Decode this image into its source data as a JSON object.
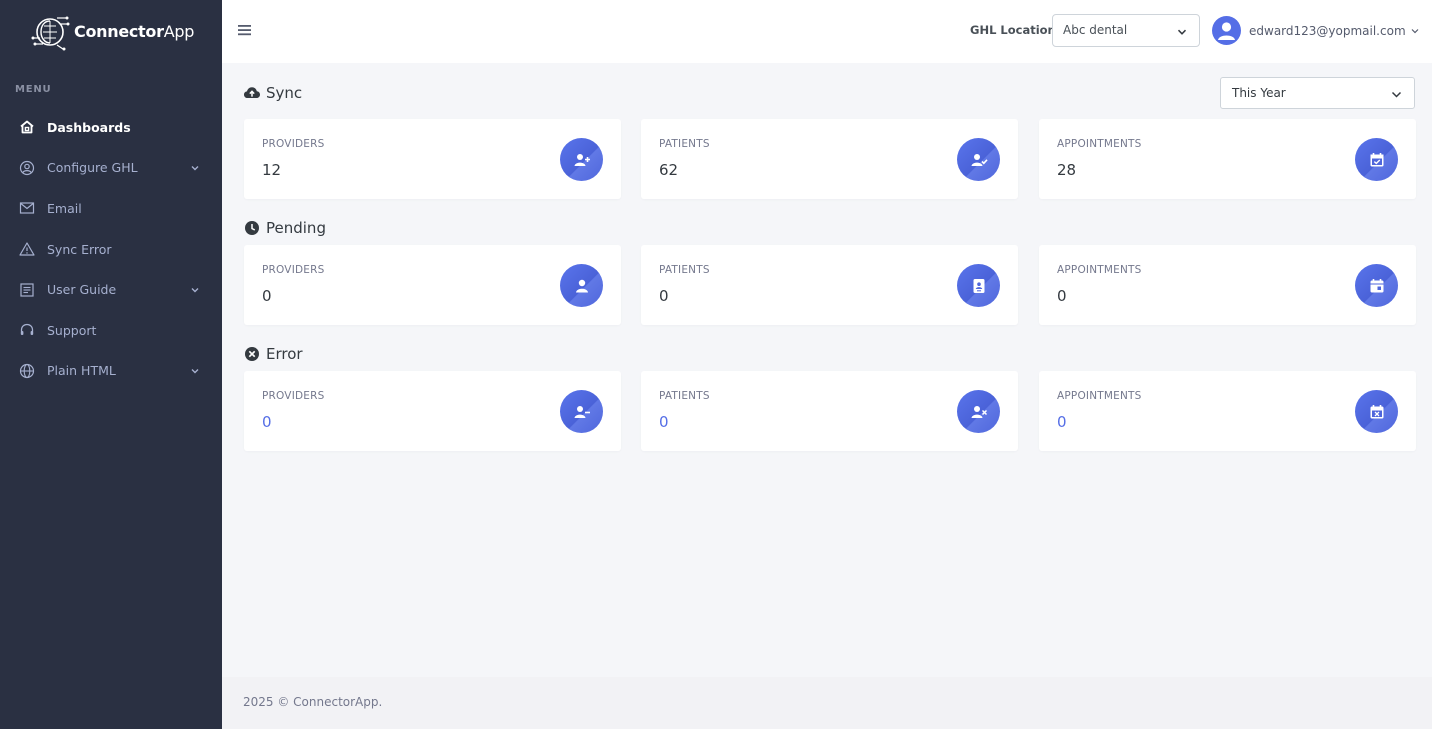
{
  "brand": {
    "name_bold": "Connector",
    "name_light": "App"
  },
  "sidebar": {
    "menu_title": "MENU",
    "items": [
      {
        "label": "Dashboards",
        "icon": "home-icon",
        "active": true,
        "has_submenu": false
      },
      {
        "label": "Configure GHL",
        "icon": "user-circle-icon",
        "active": false,
        "has_submenu": true
      },
      {
        "label": "Email",
        "icon": "envelope-icon",
        "active": false,
        "has_submenu": false
      },
      {
        "label": "Sync Error",
        "icon": "warning-icon",
        "active": false,
        "has_submenu": false
      },
      {
        "label": "User Guide",
        "icon": "document-icon",
        "active": false,
        "has_submenu": true
      },
      {
        "label": "Plain HTML",
        "icon": "globe-icon",
        "active": false,
        "has_submenu": true
      }
    ],
    "support_label": "Support"
  },
  "topbar": {
    "ghl_label": "GHL Location:",
    "ghl_value": "Abc dental",
    "user_email": "edward123@yopmail.com"
  },
  "filter": {
    "period": "This Year"
  },
  "sections": [
    {
      "title": "Sync",
      "icon": "cloud-upload-icon",
      "cards": [
        {
          "label": "PROVIDERS",
          "value": "12",
          "icon": "user-plus-icon"
        },
        {
          "label": "PATIENTS",
          "value": "62",
          "icon": "user-check-icon"
        },
        {
          "label": "APPOINTMENTS",
          "value": "28",
          "icon": "calendar-check-icon"
        }
      ]
    },
    {
      "title": "Pending",
      "icon": "clock-icon",
      "cards": [
        {
          "label": "PROVIDERS",
          "value": "0",
          "icon": "user-icon"
        },
        {
          "label": "PATIENTS",
          "value": "0",
          "icon": "id-card-icon"
        },
        {
          "label": "APPOINTMENTS",
          "value": "0",
          "icon": "calendar-icon"
        }
      ]
    },
    {
      "title": "Error",
      "icon": "times-circle-icon",
      "cards": [
        {
          "label": "PROVIDERS",
          "value": "0",
          "icon": "user-minus-icon"
        },
        {
          "label": "PATIENTS",
          "value": "0",
          "icon": "user-times-icon"
        },
        {
          "label": "APPOINTMENTS",
          "value": "0",
          "icon": "calendar-times-icon"
        }
      ]
    }
  ],
  "footer": {
    "text": "2025 © ConnectorApp."
  },
  "colors": {
    "sidebar_bg": "#2a3042",
    "accent": "#556ee6",
    "page_bg": "#f5f6f9"
  }
}
